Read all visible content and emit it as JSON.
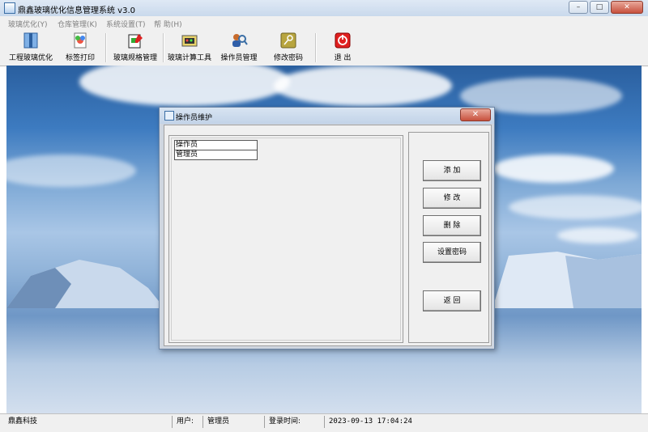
{
  "window": {
    "title": "鼎鑫玻璃优化信息管理系统 v3.0",
    "minimize": "–",
    "maximize": "□",
    "close": "✕"
  },
  "menu": [
    "玻璃优化(Y)",
    "仓库管理(K)",
    "系统设置(T)",
    "帮 助(H)"
  ],
  "toolbar": [
    {
      "label": "工程玻璃优化",
      "icon": "book-icon"
    },
    {
      "label": "标签打印",
      "icon": "label-print-icon"
    },
    {
      "label": "玻璃规格管理",
      "icon": "spec-edit-icon"
    },
    {
      "label": "玻璃计算工具",
      "icon": "calculator-icon"
    },
    {
      "label": "操作员管理",
      "icon": "operator-search-icon"
    },
    {
      "label": "修改密码",
      "icon": "key-icon"
    },
    {
      "label": "退 出",
      "icon": "power-icon"
    }
  ],
  "dialog": {
    "title": "操作员维护",
    "close": "✕",
    "list": [
      "操作员",
      "管理员"
    ],
    "buttons": {
      "add": "添 加",
      "edit": "修 改",
      "delete": "删 除",
      "set_password": "设置密码",
      "back": "返 回"
    }
  },
  "status": {
    "company": "鼎鑫科技",
    "user_label": "用户:",
    "user": "管理员",
    "login_label": "登录时间:",
    "login_time": "2023-09-13 17:04:24"
  },
  "colors": {
    "accent": "#3a6ea5",
    "close_red": "#c7503d"
  }
}
